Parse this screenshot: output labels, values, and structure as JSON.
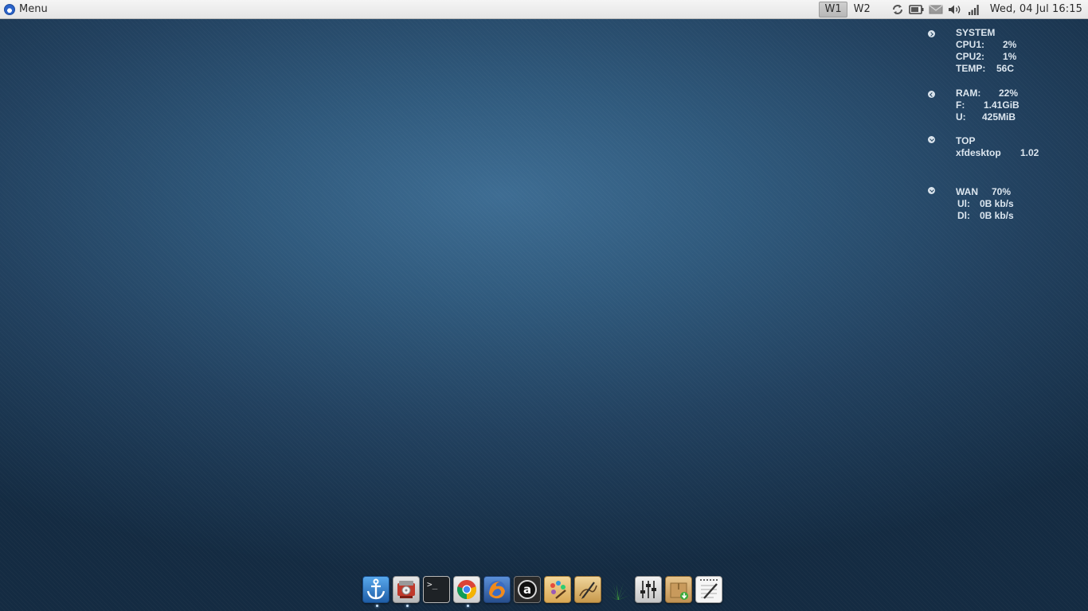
{
  "panel": {
    "menu_label": "Menu",
    "workspaces": [
      "W1",
      "W2"
    ],
    "active_workspace": "W1",
    "tray_icons": [
      "sync-icon",
      "battery-icon",
      "mail-icon",
      "volume-icon",
      "signal-icon"
    ],
    "clock": "Wed, 04 Jul  16:15"
  },
  "conky": {
    "system": {
      "heading": "SYSTEM",
      "cpu1_label": "CPU1:",
      "cpu1_value": "2%",
      "cpu2_label": "CPU2:",
      "cpu2_value": "1%",
      "temp_label": "TEMP:",
      "temp_value": "56C"
    },
    "memory": {
      "ram_label": "RAM:",
      "ram_value": "22%",
      "free_label": "F:",
      "free_value": "1.41GiB",
      "used_label": "U:",
      "used_value": "425MiB"
    },
    "top": {
      "heading": "TOP",
      "process_name": "xfdesktop",
      "process_value": "1.02"
    },
    "network": {
      "wan_label": "WAN",
      "wan_value": "70%",
      "ul_label": "Ul:",
      "ul_value": "0B kb/s",
      "dl_label": "Dl:",
      "dl_value": "0B kb/s"
    }
  },
  "dock": {
    "items": [
      {
        "icon": "anchor-icon",
        "running": true
      },
      {
        "icon": "disk-burner-icon",
        "running": true
      },
      {
        "icon": "terminal-icon",
        "running": false
      },
      {
        "icon": "chrome-icon",
        "running": true
      },
      {
        "icon": "firefox-icon",
        "running": false
      },
      {
        "icon": "amarok-icon",
        "running": false
      },
      {
        "icon": "paint-icon",
        "running": false
      },
      {
        "icon": "draw-icon",
        "running": false
      },
      {
        "icon": "plant-icon",
        "running": false
      },
      {
        "icon": "mixer-icon",
        "running": false
      },
      {
        "icon": "package-installer-icon",
        "running": false
      },
      {
        "icon": "text-editor-icon",
        "running": false
      }
    ],
    "terminal_prompt": ">_",
    "amarok_letter": "a"
  },
  "colors": {
    "panel_bg": "#ececec",
    "desktop_center": "#3e6d93",
    "desktop_edge": "#142b42",
    "conky_text": "#dce6ef"
  }
}
